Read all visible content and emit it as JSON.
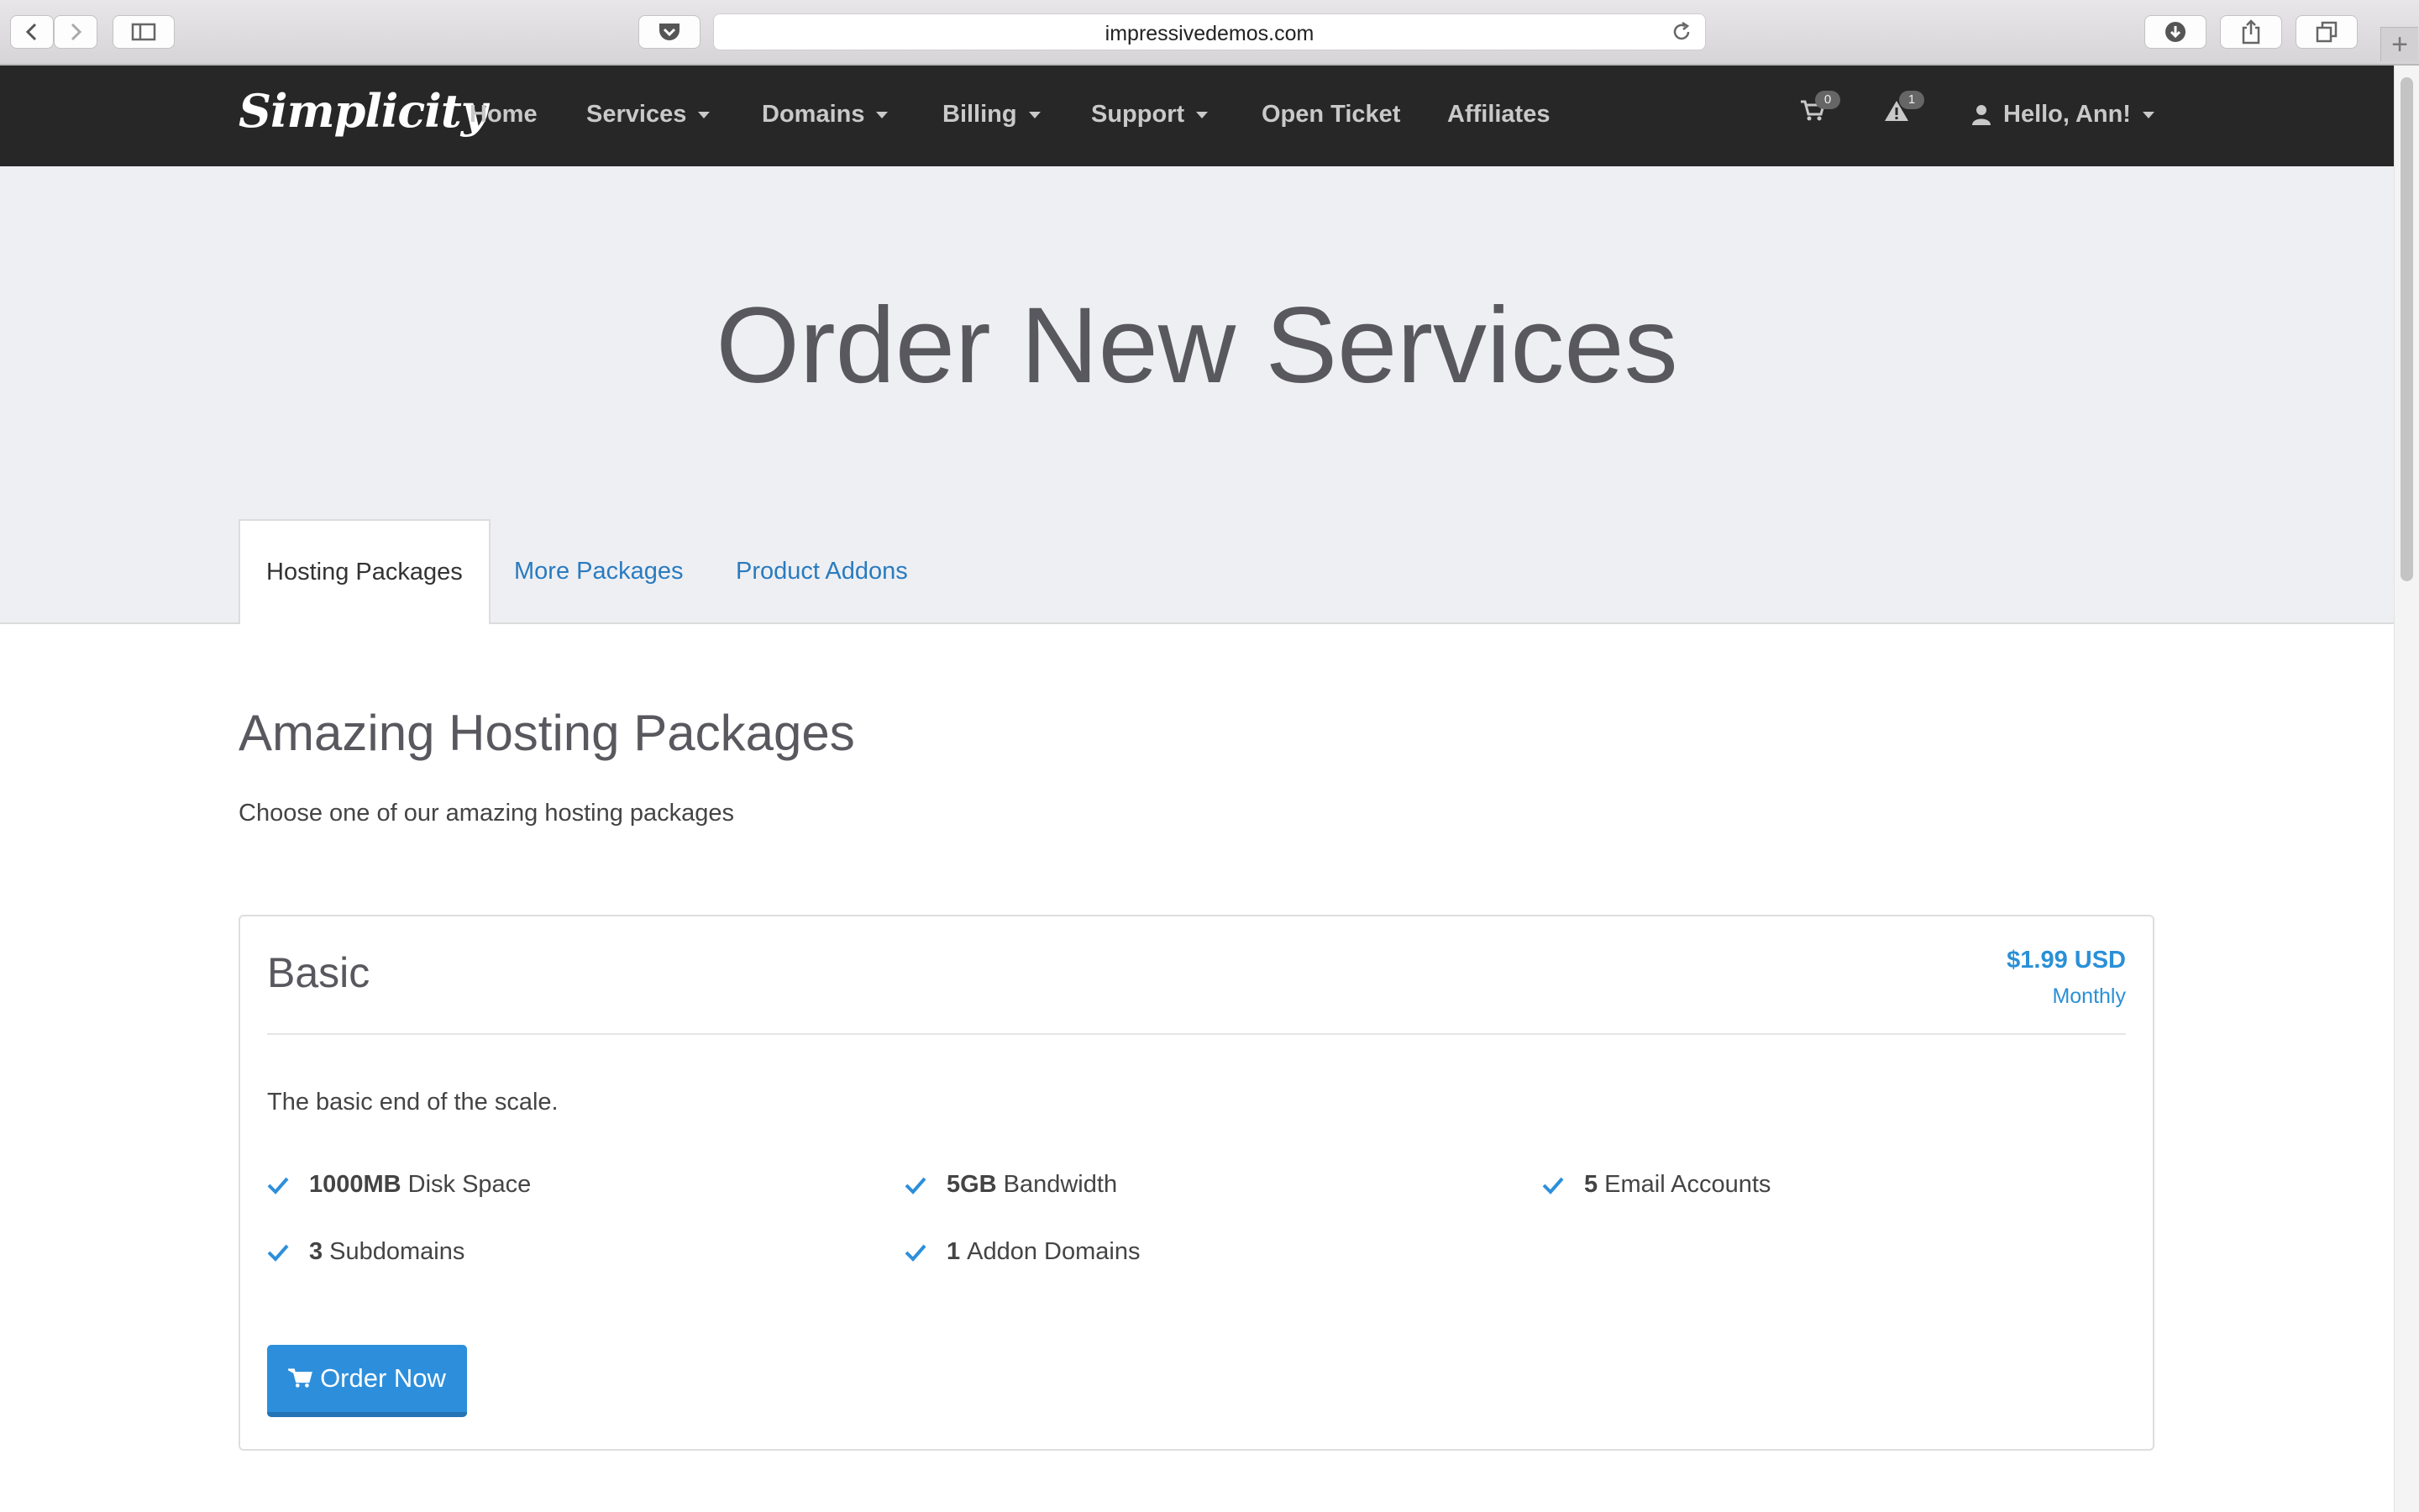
{
  "browser": {
    "url": "impressivedemos.com"
  },
  "navbar": {
    "logo": "Simplicity",
    "items": [
      {
        "label": "Home"
      },
      {
        "label": "Services"
      },
      {
        "label": "Domains"
      },
      {
        "label": "Billing"
      },
      {
        "label": "Support"
      },
      {
        "label": "Open Ticket"
      },
      {
        "label": "Affiliates"
      }
    ],
    "cart_count": "0",
    "alert_count": "1",
    "user_label": "Hello, Ann!"
  },
  "hero": {
    "title": "Order New Services"
  },
  "tabs": [
    {
      "label": "Hosting Packages",
      "active": true
    },
    {
      "label": "More Packages",
      "active": false
    },
    {
      "label": "Product Addons",
      "active": false
    }
  ],
  "section": {
    "title": "Amazing Hosting Packages",
    "subtitle": "Choose one of our amazing hosting packages"
  },
  "package": {
    "name": "Basic",
    "price": "$1.99 USD",
    "cycle": "Monthly",
    "description": "The basic end of the scale.",
    "features": [
      {
        "value": "1000MB",
        "label": "Disk Space"
      },
      {
        "value": "5GB",
        "label": "Bandwidth"
      },
      {
        "value": "5",
        "label": "Email Accounts"
      },
      {
        "value": "3",
        "label": "Subdomains"
      },
      {
        "value": "1",
        "label": "Addon Domains"
      }
    ],
    "order_label": "Order Now"
  },
  "colors": {
    "navbar_bg": "#272727",
    "hero_bg": "#eeeff3",
    "accent": "#2d8fdb",
    "link": "#2a7bbf"
  }
}
